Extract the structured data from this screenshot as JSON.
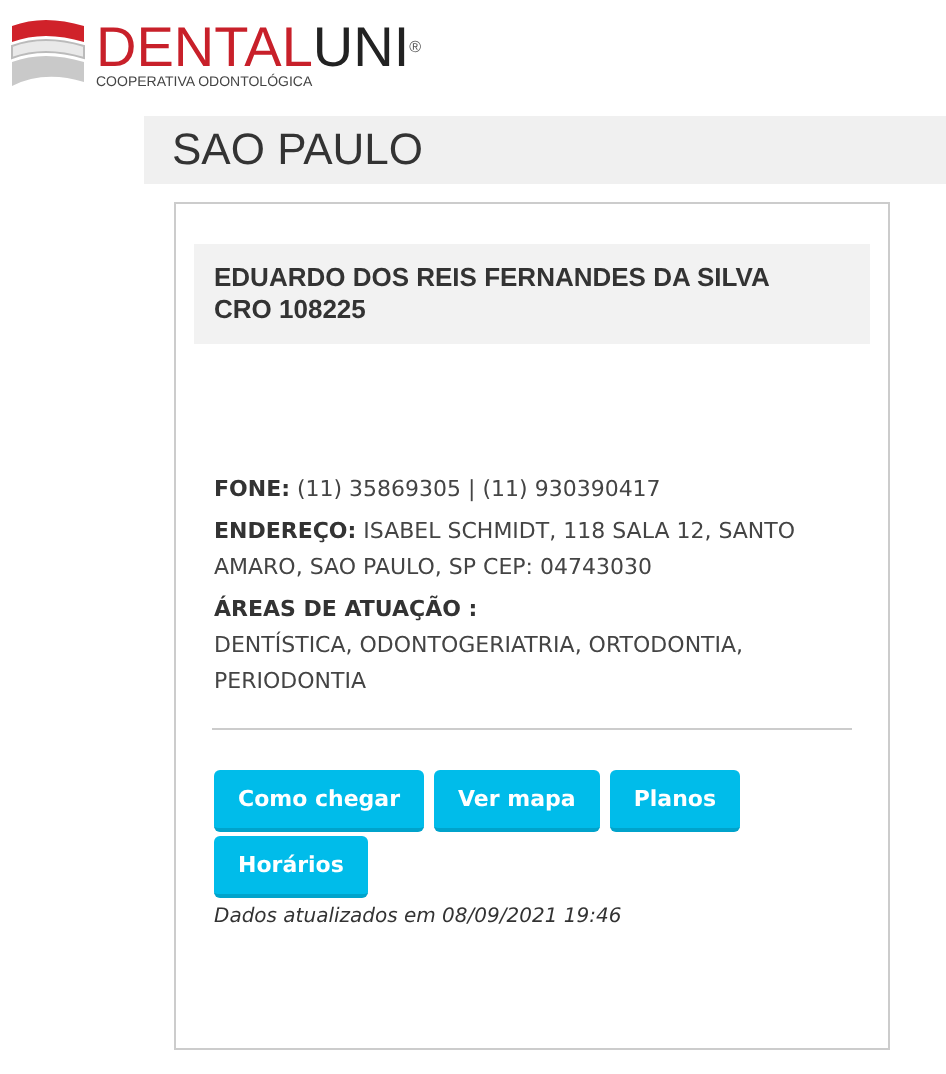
{
  "logo": {
    "brand_part_1": "DENTAL",
    "brand_part_2": "UNI",
    "registered": "®",
    "tagline": "COOPERATIVA ODONTOLÓGICA"
  },
  "city": "SAO PAULO",
  "card": {
    "name": "EDUARDO DOS REIS FERNANDES DA SILVA",
    "registration": "CRO 108225",
    "info": [
      {
        "kind": "inline",
        "label": "FONE:",
        "value": "(11) 35869305 | (11) 930390417"
      },
      {
        "kind": "inline",
        "label": "ENDEREÇO:",
        "value": "ISABEL SCHMIDT, 118 SALA 12, SANTO AMARO, SAO PAULO, SP CEP: 04743030"
      },
      {
        "kind": "block",
        "label": "ÁREAS DE ATUAÇÃO :",
        "value": "DENTÍSTICA, ODONTOGERIATRIA, ORTODONTIA, PERIODONTIA"
      }
    ],
    "buttons": [
      "Como chegar",
      "Ver mapa",
      "Planos",
      "Horários"
    ],
    "updated": "Dados atualizados em 08/09/2021 19:46"
  }
}
